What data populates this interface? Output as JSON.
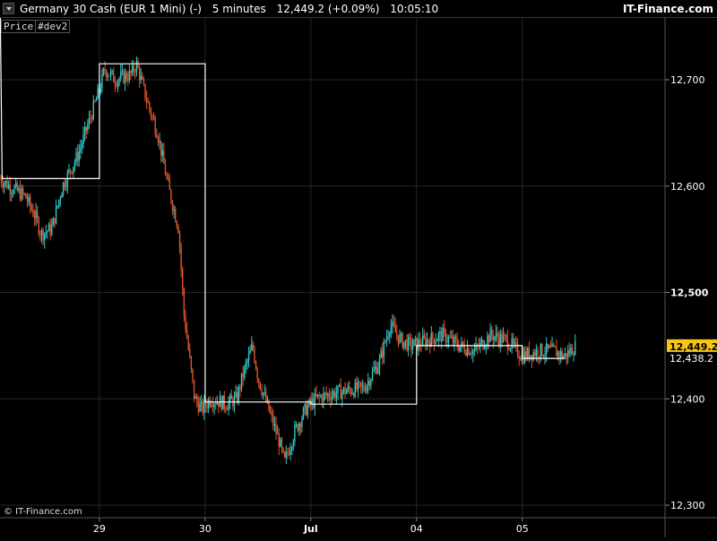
{
  "header": {
    "instrument": "Germany 30 Cash (EUR 1 Mini) (-)",
    "timeframe": "5 minutes",
    "last": "12,449.2 (+0.09%)",
    "time": "10:05:10",
    "brand": "IT-Finance.com"
  },
  "indicator": {
    "price": "Price",
    "name": "#dev2"
  },
  "footer": "© IT-Finance.com",
  "colors": {
    "up": "#2fc6c6",
    "down": "#e0552a",
    "overlay": "#ffffff",
    "grid": "#262626",
    "highlight": "#f5c518"
  },
  "chart_data": {
    "type": "candlestick",
    "ylim": [
      12300,
      12800
    ],
    "yticks": [
      {
        "value": 12300,
        "label": "12,300"
      },
      {
        "value": 12400,
        "label": "12,400"
      },
      {
        "value": 12500,
        "label": "12,500",
        "bold": true
      },
      {
        "value": 12600,
        "label": "12,600"
      },
      {
        "value": 12700,
        "label": "12,700"
      }
    ],
    "xticks": [
      {
        "label": "29",
        "x": 29.0
      },
      {
        "label": "30",
        "x": 30.0
      },
      {
        "label": "Jul",
        "x": 31.0,
        "bold": true
      },
      {
        "label": "04",
        "x": 32.0
      },
      {
        "label": "05",
        "x": 33.0
      }
    ],
    "xlim": [
      28.06,
      34.35
    ],
    "series": [
      {
        "name": "Price",
        "price_path": [
          [
            28.06,
            12607
          ],
          [
            28.15,
            12600
          ],
          [
            28.3,
            12590
          ],
          [
            28.4,
            12570
          ],
          [
            28.45,
            12555
          ],
          [
            28.55,
            12560
          ],
          [
            28.65,
            12600
          ],
          [
            28.8,
            12630
          ],
          [
            28.9,
            12660
          ],
          [
            28.95,
            12675
          ],
          [
            29.0,
            12690
          ],
          [
            29.05,
            12710
          ],
          [
            29.15,
            12700
          ],
          [
            29.3,
            12705
          ],
          [
            29.35,
            12715
          ],
          [
            29.45,
            12680
          ],
          [
            29.55,
            12650
          ],
          [
            29.65,
            12600
          ],
          [
            29.75,
            12560
          ],
          [
            29.8,
            12480
          ],
          [
            29.85,
            12440
          ],
          [
            29.9,
            12400
          ],
          [
            29.97,
            12390
          ],
          [
            30.05,
            12400
          ],
          [
            30.2,
            12395
          ],
          [
            30.3,
            12400
          ],
          [
            30.35,
            12420
          ],
          [
            30.45,
            12450
          ],
          [
            30.5,
            12420
          ],
          [
            30.6,
            12390
          ],
          [
            30.7,
            12360
          ],
          [
            30.75,
            12340
          ],
          [
            30.85,
            12370
          ],
          [
            30.95,
            12390
          ],
          [
            31.05,
            12400
          ],
          [
            31.2,
            12405
          ],
          [
            31.35,
            12408
          ],
          [
            31.5,
            12410
          ],
          [
            31.65,
            12435
          ],
          [
            31.75,
            12470
          ],
          [
            31.85,
            12455
          ],
          [
            31.95,
            12450
          ],
          [
            32.1,
            12455
          ],
          [
            32.25,
            12460
          ],
          [
            32.4,
            12450
          ],
          [
            32.55,
            12445
          ],
          [
            32.7,
            12460
          ],
          [
            32.85,
            12455
          ],
          [
            33.0,
            12440
          ],
          [
            33.15,
            12445
          ],
          [
            33.3,
            12445
          ],
          [
            33.4,
            12440
          ],
          [
            33.5,
            12449.2
          ]
        ]
      }
    ],
    "overlay": {
      "name": "#dev2",
      "steps": [
        [
          28.06,
          12785
        ],
        [
          28.08,
          12607
        ],
        [
          29.0,
          12607
        ],
        [
          29.0,
          12715
        ],
        [
          30.0,
          12715
        ],
        [
          30.0,
          12397
        ],
        [
          31.0,
          12397
        ],
        [
          31.0,
          12395
        ],
        [
          32.0,
          12395
        ],
        [
          32.0,
          12450
        ],
        [
          33.0,
          12450
        ],
        [
          33.0,
          12438
        ],
        [
          33.4,
          12438
        ]
      ]
    },
    "last_price": {
      "value": 12449.2,
      "label": "12,449.2"
    },
    "overlay_last": {
      "value": 12438.2,
      "label": "12,438.2"
    }
  }
}
